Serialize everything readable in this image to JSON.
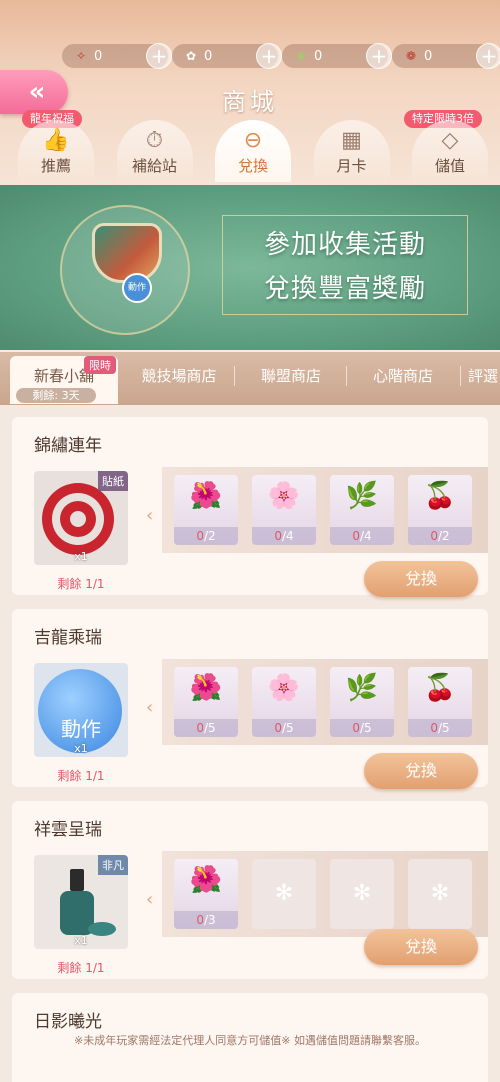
{
  "currencies": [
    {
      "icon": "✧",
      "value": "0"
    },
    {
      "icon": "✿",
      "value": "0"
    },
    {
      "icon": "❀",
      "value": "0"
    },
    {
      "icon": "❁",
      "value": "0"
    }
  ],
  "header": {
    "title": "商城",
    "badge_left": "龍年祝福",
    "badge_right": "特定限時3倍",
    "tabs": [
      {
        "label": "推薦",
        "icon": "👍"
      },
      {
        "label": "補給站",
        "icon": "⏱"
      },
      {
        "label": "兌換",
        "icon": "⊖"
      },
      {
        "label": "月卡",
        "icon": "▦"
      },
      {
        "label": "儲值",
        "icon": "◇"
      }
    ]
  },
  "banner": {
    "line1": "參加收集活動",
    "line2": "兌換豐富獎勵",
    "badge": "動作"
  },
  "subtabs": {
    "items": [
      "新春小舖",
      "競技場商店",
      "聯盟商店",
      "心階商店",
      "評選"
    ],
    "limit_badge": "限時",
    "remain": "剩餘: 3天"
  },
  "cards": [
    {
      "title": "錦繡連年",
      "reward_tag": "貼紙",
      "reward_qty": "x1",
      "remain": "剩餘 1/1",
      "mats": [
        {
          "icon": "🌺",
          "have": "0",
          "need": "/2"
        },
        {
          "icon": "🌸",
          "have": "0",
          "need": "/4"
        },
        {
          "icon": "🌿",
          "have": "0",
          "need": "/4"
        },
        {
          "icon": "🍒",
          "have": "0",
          "need": "/2"
        }
      ],
      "button": "兌換"
    },
    {
      "title": "吉龍乘瑞",
      "reward_tag": "動作",
      "reward_qty": "x1",
      "remain": "剩餘 1/1",
      "mats": [
        {
          "icon": "🌺",
          "have": "0",
          "need": "/5"
        },
        {
          "icon": "🌸",
          "have": "0",
          "need": "/5"
        },
        {
          "icon": "🌿",
          "have": "0",
          "need": "/5"
        },
        {
          "icon": "🍒",
          "have": "0",
          "need": "/5"
        }
      ],
      "button": "兌換"
    },
    {
      "title": "祥雲呈瑞",
      "reward_tag": "非凡",
      "reward_qty": "x1",
      "remain": "剩餘 1/1",
      "mats": [
        {
          "icon": "🌺",
          "have": "0",
          "need": "/3"
        }
      ],
      "button": "兌換"
    },
    {
      "title": "日影曦光"
    }
  ],
  "footer": "※未成年玩家需經法定代理人同意方可儲值※ 如遇儲值問題請聯繫客服。"
}
